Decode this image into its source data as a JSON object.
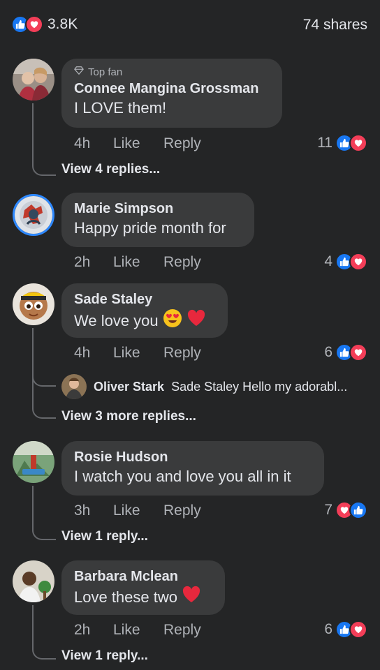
{
  "header": {
    "reaction_count": "3.8K",
    "shares": "74 shares"
  },
  "comments": [
    {
      "top_fan_label": "Top fan",
      "author": "Connee Mangina Grossman",
      "text": "I LOVE them!",
      "time": "4h",
      "like_label": "Like",
      "reply_label": "Reply",
      "reaction_count": "11",
      "view_replies": "View 4 replies..."
    },
    {
      "author": "Marie Simpson",
      "text": "Happy pride month for",
      "time": "2h",
      "like_label": "Like",
      "reply_label": "Reply",
      "reaction_count": "4"
    },
    {
      "author": "Sade Staley",
      "text": "We love you",
      "time": "4h",
      "like_label": "Like",
      "reply_label": "Reply",
      "reaction_count": "6",
      "reply_preview": {
        "author": "Oliver Stark",
        "text": "Sade Staley Hello my adorabl..."
      },
      "view_replies": "View 3 more replies..."
    },
    {
      "author": "Rosie Hudson",
      "text": "I watch you and love you all in it",
      "time": "3h",
      "like_label": "Like",
      "reply_label": "Reply",
      "reaction_count": "7",
      "view_replies": "View 1 reply..."
    },
    {
      "author": "Barbara Mclean",
      "text": "Love these two",
      "time": "2h",
      "like_label": "Like",
      "reply_label": "Reply",
      "reaction_count": "6",
      "view_replies": "View 1 reply..."
    }
  ],
  "icons": {
    "like": "thumbs-up-icon",
    "love": "heart-icon",
    "top_fan": "diamond-icon"
  },
  "colors": {
    "background": "#242526",
    "bubble": "#3a3b3c",
    "like_blue": "#1877f2",
    "love_red": "#f33e58"
  }
}
